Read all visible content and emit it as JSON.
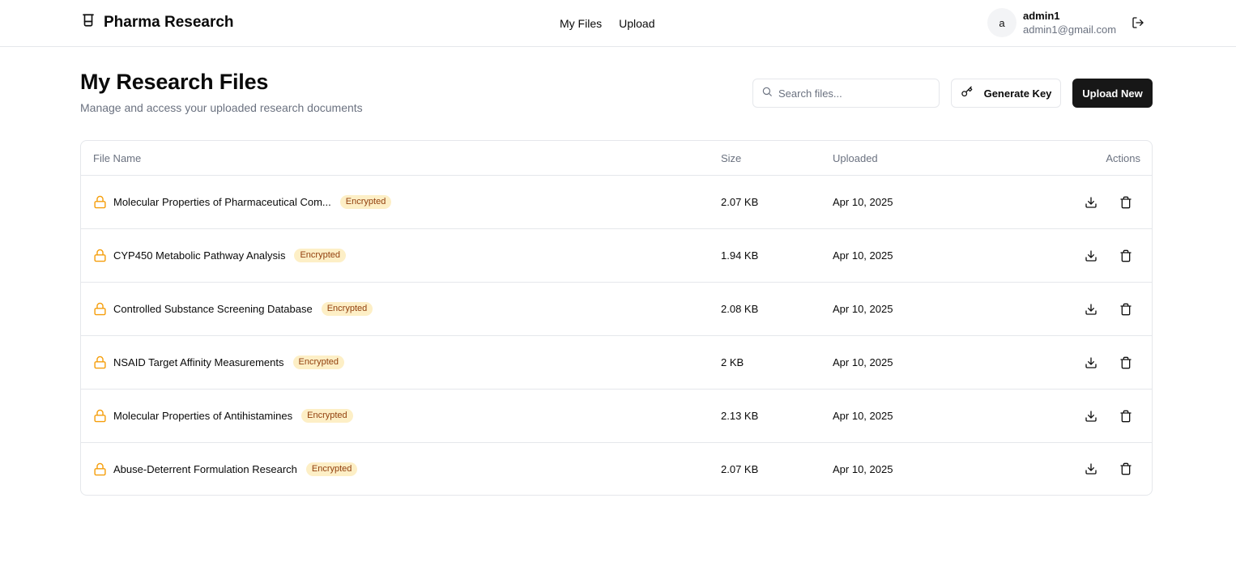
{
  "header": {
    "brand": "Pharma Research",
    "nav": [
      "My Files",
      "Upload"
    ],
    "user": {
      "initial": "a",
      "name": "admin1",
      "email": "admin1@gmail.com"
    }
  },
  "page": {
    "title": "My Research Files",
    "subtitle": "Manage and access your uploaded research documents"
  },
  "toolbar": {
    "search_placeholder": "Search files...",
    "generate_key_label": "Generate Key",
    "upload_label": "Upload New"
  },
  "table": {
    "columns": [
      "File Name",
      "Size",
      "Uploaded",
      "Actions"
    ],
    "rows": [
      {
        "name": "Molecular Properties of Pharmaceutical Com...",
        "badge": "Encrypted",
        "size": "2.07 KB",
        "uploaded": "Apr 10, 2025"
      },
      {
        "name": "CYP450 Metabolic Pathway Analysis",
        "badge": "Encrypted",
        "size": "1.94 KB",
        "uploaded": "Apr 10, 2025"
      },
      {
        "name": "Controlled Substance Screening Database",
        "badge": "Encrypted",
        "size": "2.08 KB",
        "uploaded": "Apr 10, 2025"
      },
      {
        "name": "NSAID Target Affinity Measurements",
        "badge": "Encrypted",
        "size": "2 KB",
        "uploaded": "Apr 10, 2025"
      },
      {
        "name": "Molecular Properties of Antihistamines",
        "badge": "Encrypted",
        "size": "2.13 KB",
        "uploaded": "Apr 10, 2025"
      },
      {
        "name": "Abuse-Deterrent Formulation Research",
        "badge": "Encrypted",
        "size": "2.07 KB",
        "uploaded": "Apr 10, 2025"
      }
    ]
  },
  "icons": {
    "brand": "beaker-icon",
    "logout": "logout-icon",
    "search": "search-icon",
    "key": "key-icon",
    "lock": "lock-icon",
    "download": "download-icon",
    "delete": "trash-icon"
  },
  "colors": {
    "primary_button": "#171717",
    "lock_icon": "#f59e0b",
    "badge_bg": "#fdefc6",
    "badge_text": "#92400e",
    "muted_text": "#6b7280",
    "border": "#e5e7eb"
  }
}
